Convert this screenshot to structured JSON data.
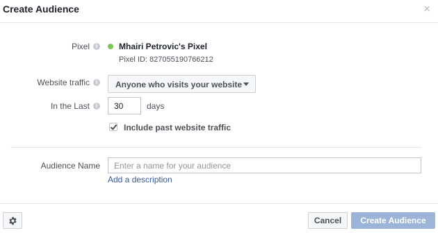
{
  "dialog": {
    "title": "Create Audience",
    "close_glyph": "×"
  },
  "pixel": {
    "label": "Pixel",
    "name": "Mhairi Petrovic's Pixel",
    "id_text": "Pixel ID: 827055190766212",
    "status_color": "#7ac74f"
  },
  "website_traffic": {
    "label": "Website traffic",
    "selected": "Anyone who visits your website"
  },
  "in_the_last": {
    "label": "In the Last",
    "value": "30",
    "unit": "days"
  },
  "include_past": {
    "label": "Include past website traffic",
    "checked": true
  },
  "audience_name": {
    "label": "Audience Name",
    "placeholder": "Enter a name for your audience",
    "value": "",
    "add_description": "Add a description"
  },
  "footer": {
    "cancel_label": "Cancel",
    "create_label": "Create Audience",
    "create_color": "#9cb4d8"
  },
  "icons": {
    "info": "info-icon",
    "gear": "gear-icon",
    "close": "close-icon",
    "caret": "caret-down-icon",
    "check": "checkmark-icon"
  }
}
